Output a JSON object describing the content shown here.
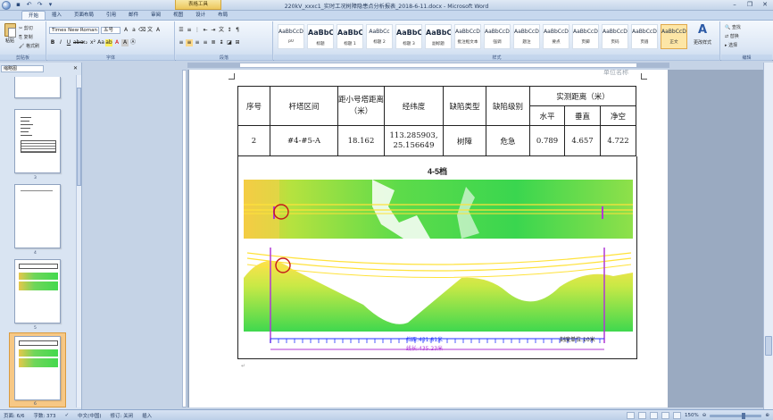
{
  "window": {
    "title": "220kV_xxxc1_实时工况树障隐患点分析报表_2018-6-11.docx - Microsoft Word",
    "context_tab": "表格工具"
  },
  "qat": [
    "save-icon",
    "undo-icon",
    "redo-icon",
    "customize-icon"
  ],
  "tabs": [
    "开始",
    "插入",
    "页面布局",
    "引用",
    "邮件",
    "审阅",
    "视图",
    "设计",
    "布局"
  ],
  "active_tab": "开始",
  "clipboard": {
    "paste": "粘贴",
    "cut": "剪切",
    "copy": "复制",
    "format_painter": "格式刷",
    "label": "剪贴板"
  },
  "font": {
    "name": "Times New Roman",
    "size": "五号",
    "label": "字体"
  },
  "paragraph": {
    "label": "段落"
  },
  "styles": {
    "label": "样式",
    "items": [
      {
        "preview": "AaBbCcDc",
        "name": "p0",
        "big": false
      },
      {
        "preview": "AaBbC",
        "name": "标题",
        "big": true
      },
      {
        "preview": "AaBbCc",
        "name": "标题 1",
        "big": true
      },
      {
        "preview": "AaBbCc",
        "name": "标题 2",
        "big": false
      },
      {
        "preview": "AaBbC",
        "name": "标题 3",
        "big": true
      },
      {
        "preview": "AaBbC",
        "name": "副标题",
        "big": true
      },
      {
        "preview": "AaBbCcDd",
        "name": "批注框文本",
        "big": false
      },
      {
        "preview": "AaBbCcDc",
        "name": "强调",
        "big": false
      },
      {
        "preview": "AaBbCcDd",
        "name": "题注",
        "big": false
      },
      {
        "preview": "AaBbCcD",
        "name": "要点",
        "big": false
      },
      {
        "preview": "AaBbCcDdE",
        "name": "页脚",
        "big": false
      },
      {
        "preview": "AaBbCcDd",
        "name": "页码",
        "big": false
      },
      {
        "preview": "AaBbCcDdE",
        "name": "页眉",
        "big": false
      },
      {
        "preview": "AaBbCcDc",
        "name": "正文",
        "big": false
      }
    ],
    "change_styles": "更改样式"
  },
  "editing": {
    "find": "查找",
    "replace": "替换",
    "select": "选择",
    "label": "编辑"
  },
  "nav": {
    "view": "缩略图",
    "pages": [
      "3",
      "4",
      "5",
      "6"
    ]
  },
  "document": {
    "unit_note": "单位名称",
    "table": {
      "headers": {
        "seq": "序号",
        "section": "杆塔区间",
        "dist_small": "距小号塔距离（米）",
        "lonlat": "经纬度",
        "type": "缺陷类型",
        "level": "缺陷级别",
        "measured": "实测距离（米）",
        "horizontal": "水平",
        "vertical": "垂直",
        "clearance": "净空"
      },
      "row": {
        "seq": "2",
        "section": "#4-#5-A",
        "dist_small": "18.162",
        "lon": "113.285903,",
        "lat": "25.156649",
        "type": "树障",
        "level": "危急",
        "horizontal": "0.789",
        "vertical": "4.657",
        "clearance": "4.722"
      }
    },
    "figure": {
      "title": "4-5档",
      "span_label": "档距:431.81米",
      "length_label": "线长:435.23米",
      "scale_label": "刻度单位:10米"
    }
  },
  "status": {
    "page": "页面: 6/6",
    "words": "字数: 373",
    "language": "中文(中国)",
    "revision": "修订: 关闭",
    "mode": "插入",
    "zoom": "150%"
  },
  "colors": {
    "accent": "#f3b25c",
    "ribbon": "#dce7f5",
    "vegetation": "#43d94e",
    "line": "#ffe23a",
    "tower": "#b037d6",
    "marker": "#c41a1a"
  }
}
